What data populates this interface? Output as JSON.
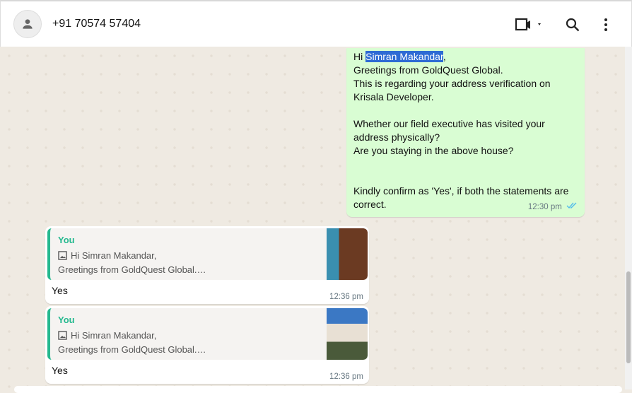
{
  "header": {
    "contact": "+91 70574 57404"
  },
  "outgoing": {
    "greeting": "Hi ",
    "name": "Simran Makandar",
    "after_name": ",",
    "body": "Greetings from GoldQuest Global.\nThis is regarding your address verification on Krisala Developer.\n\nWhether our field executive has visited your address physically?\nAre you staying in the above house?\n\n\nKindly confirm as 'Yes', if both the statements are correct.",
    "time": "12:30 pm"
  },
  "replies": [
    {
      "quote_author": "You",
      "quote_line1": "Hi Simran Makandar,",
      "quote_line2": "Greetings from GoldQuest Global.…",
      "text": "Yes",
      "time": "12:36 pm"
    },
    {
      "quote_author": "You",
      "quote_line1": "Hi Simran Makandar,",
      "quote_line2": "Greetings from GoldQuest Global.…",
      "text": "Yes",
      "time": "12:36 pm"
    }
  ],
  "colors": {
    "accent": "#25b98f",
    "outgoing_bg": "#d9fdd3",
    "chat_bg": "#efeae2",
    "read_tick": "#53bdeb"
  }
}
